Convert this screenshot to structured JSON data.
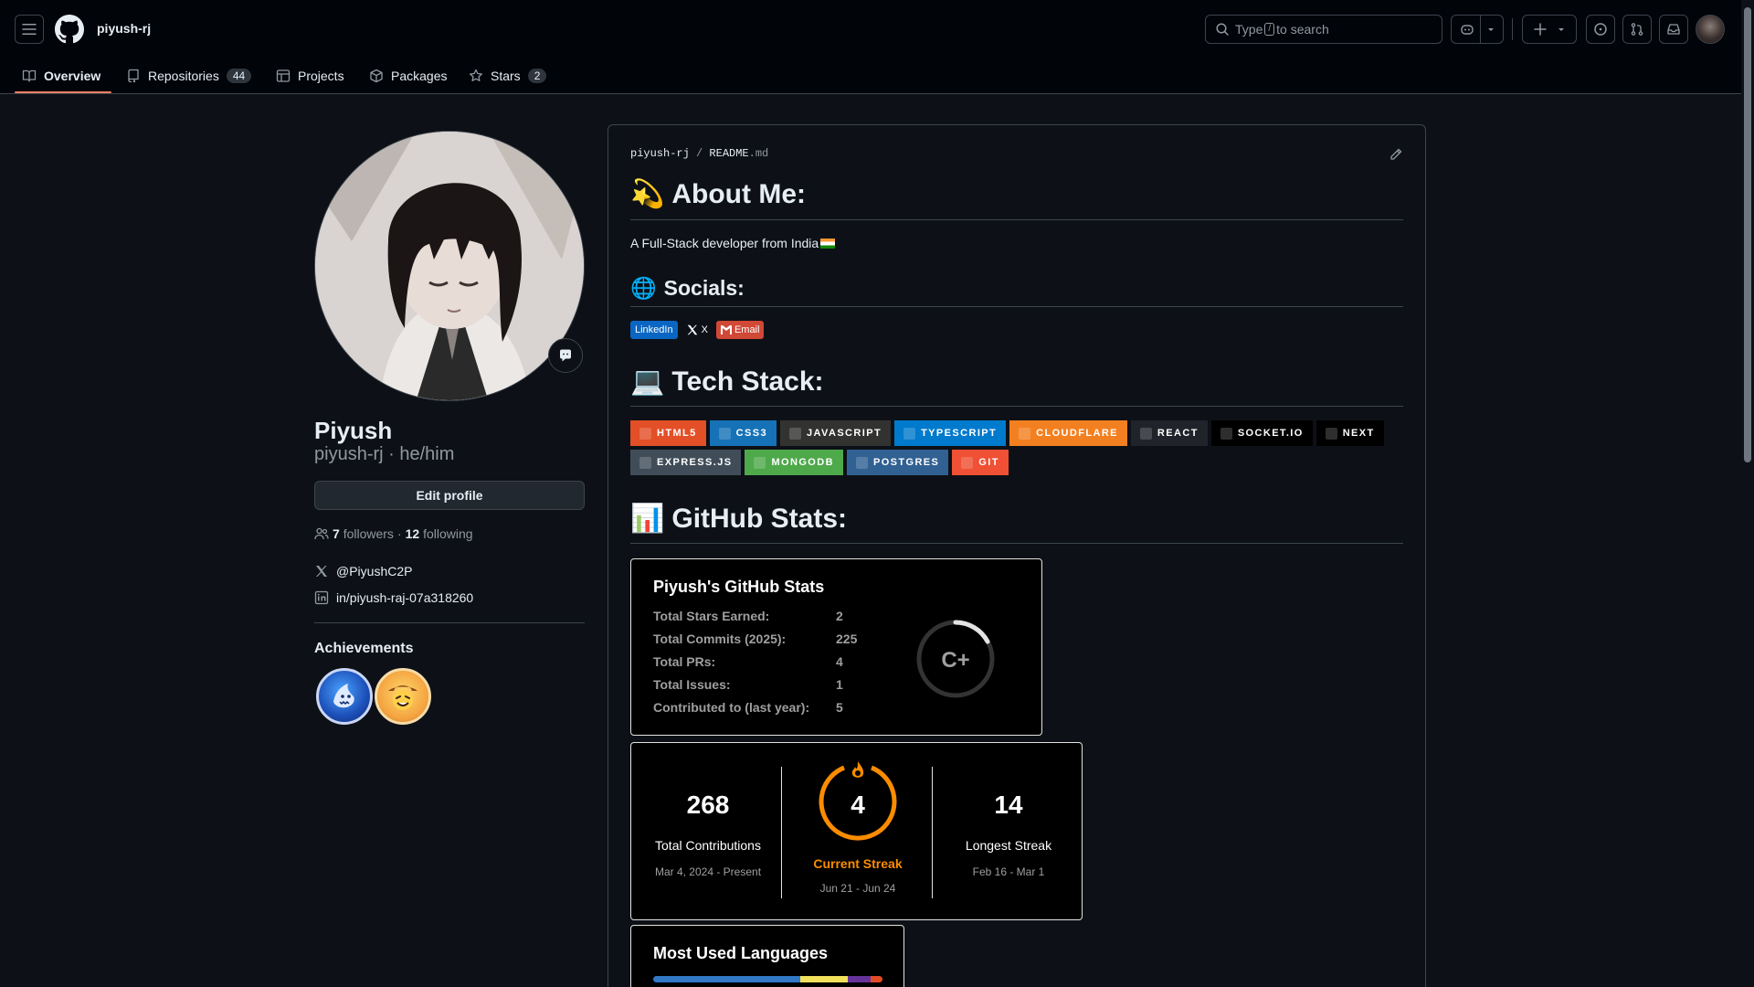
{
  "header": {
    "context_name": "piyush-rj",
    "search_prefix": "Type",
    "search_key": "/",
    "search_suffix": "to search"
  },
  "tabs": [
    {
      "label": "Overview",
      "icon": "book-icon",
      "active": true
    },
    {
      "label": "Repositories",
      "icon": "repo-icon",
      "count": "44"
    },
    {
      "label": "Projects",
      "icon": "table-icon"
    },
    {
      "label": "Packages",
      "icon": "package-icon"
    },
    {
      "label": "Stars",
      "icon": "star-icon",
      "count": "2"
    }
  ],
  "profile": {
    "name": "Piyush",
    "login_line": "piyush-rj · he/him",
    "edit_label": "Edit profile",
    "followers_count": "7",
    "followers_label": "followers",
    "sep": "·",
    "following_count": "12",
    "following_label": "following",
    "twitter": "@PiyushC2P",
    "linkedin": "in/piyush-raj-07a318260",
    "achievements_title": "Achievements"
  },
  "readme": {
    "owner": "piyush-rj",
    "sep": "/",
    "file": "README",
    "ext": ".md",
    "about_emoji": "💫",
    "about_title": "About Me:",
    "about_text": "A Full-Stack developer from India",
    "socials_emoji": "🌐",
    "socials_title": "Socials:",
    "social_badges": [
      "LinkedIn",
      "X",
      "Email"
    ],
    "tech_emoji": "💻",
    "tech_title": "Tech Stack:",
    "tech_badges": [
      {
        "label": "HTML5",
        "color": "#e34f26",
        "icon": "html5-icon"
      },
      {
        "label": "CSS3",
        "color": "#1572b6",
        "icon": "css3-icon"
      },
      {
        "label": "JavaScript",
        "color": "#323330",
        "icon": "javascript-icon"
      },
      {
        "label": "TypeScript",
        "color": "#007acc",
        "icon": "typescript-icon"
      },
      {
        "label": "Cloudflare",
        "color": "#f38020",
        "icon": "cloudflare-icon"
      },
      {
        "label": "React",
        "color": "#20232a",
        "icon": "react-icon"
      },
      {
        "label": "Socket.io",
        "color": "#000000",
        "icon": "socketio-icon"
      },
      {
        "label": "Next",
        "color": "#000000",
        "icon": "nextjs-icon"
      },
      {
        "label": "Express.js",
        "color": "#404d59",
        "icon": "express-icon"
      },
      {
        "label": "MongoDB",
        "color": "#4ea94b",
        "icon": "mongodb-icon"
      },
      {
        "label": "Postgres",
        "color": "#316192",
        "icon": "postgres-icon"
      },
      {
        "label": "Git",
        "color": "#f05033",
        "icon": "git-icon"
      }
    ],
    "stats_emoji": "📊",
    "stats_title": "GitHub Stats:"
  },
  "stats_card": {
    "title": "Piyush's GitHub Stats",
    "rows": [
      {
        "label": "Total Stars Earned:",
        "value": "2"
      },
      {
        "label": "Total Commits (2025):",
        "value": "225"
      },
      {
        "label": "Total PRs:",
        "value": "4"
      },
      {
        "label": "Total Issues:",
        "value": "1"
      },
      {
        "label": "Contributed to (last year):",
        "value": "5"
      }
    ],
    "rank": "C+"
  },
  "streak_card": {
    "total": "268",
    "total_label": "Total Contributions",
    "total_range": "Mar 4, 2024 - Present",
    "current": "4",
    "current_label": "Current Streak",
    "current_range": "Jun 21 - Jun 24",
    "longest": "14",
    "longest_label": "Longest Streak",
    "longest_range": "Feb 16 - Mar 1"
  },
  "languages_card": {
    "title": "Most Used Languages",
    "segments": [
      {
        "color": "#3178c6",
        "share": 0.64
      },
      {
        "color": "#f1e05a",
        "share": 0.21
      },
      {
        "color": "#663399",
        "share": 0.1
      },
      {
        "color": "#e34c26",
        "share": 0.05
      }
    ]
  },
  "colors": {
    "accent_tab": "#f78166",
    "streak_orange": "#fb8c00",
    "rank_ring": "#e4e2e2"
  }
}
